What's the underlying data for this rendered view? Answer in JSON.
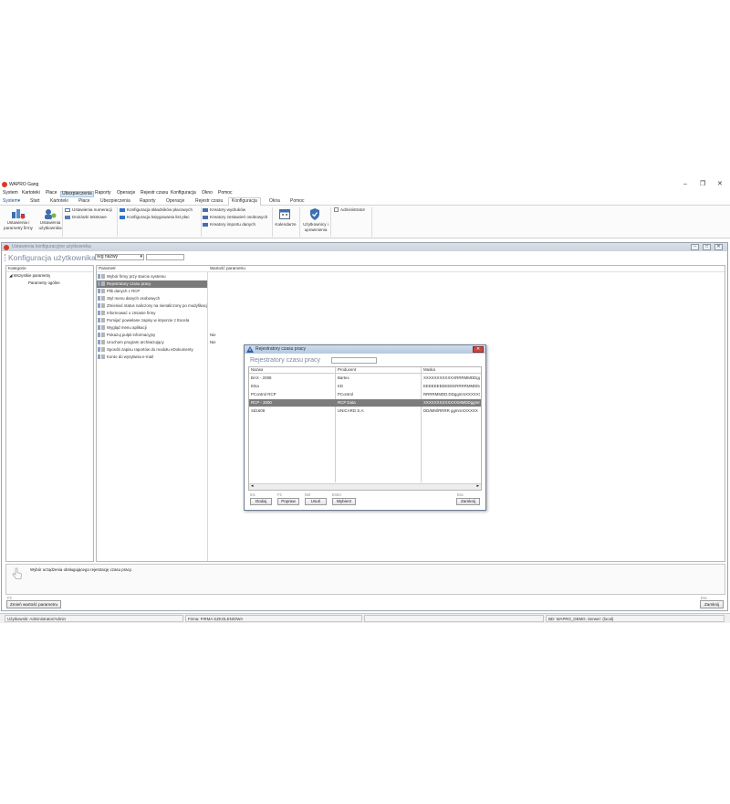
{
  "app": {
    "title": "WAPRO Gang",
    "window_controls": {
      "minimize": "–",
      "maximize": "❐",
      "close": "✕"
    }
  },
  "menu": [
    "System",
    "Kartoteki",
    "Płace",
    "Ubezpieczenia",
    "Raporty",
    "Operacje",
    "Rejestr czasu",
    "Konfiguracja",
    "Okno",
    "Pomoc"
  ],
  "menu_active": "Ubezpieczenia",
  "tabs": [
    "System",
    "Start",
    "Kartoteki",
    "Płace",
    "Ubezpieczenia",
    "Raporty",
    "Operacje",
    "Rejestr czasu",
    "Konfiguracja",
    "Okna",
    "Pomoc"
  ],
  "tab_active": "Konfiguracja",
  "ribbon": {
    "company_settings": "Ustawienia i parametry firmy",
    "user_settings": "Ustawienia użytkownika",
    "numbering": "Ustawienia numeracji",
    "text_printouts": "Druk/arki tekstowe",
    "payroll_config": "Konfiguracja składników płacowych",
    "ledger_config": "Konfiguracja księgowania list płac",
    "printout_wizards": "Kreatory wydruków",
    "staffing_wizards": "Kreatory zestawień osobowych",
    "import_wizards": "Kreatory importu danych",
    "calendars": "Kalendarze",
    "users_permissions": "Użytkownicy i uprawnienia",
    "administrator": "Administrator"
  },
  "child": {
    "window_title": "Ustawienia konfiguracyjne użytkownika",
    "page_title": "Konfiguracja użytkownika",
    "filter_value": "Wg nazwy",
    "categories_header": "Kategorie",
    "categories": [
      "Wszystkie parametry",
      "Parametry ogólne"
    ],
    "param_header": "Parametr",
    "value_header": "Wartość parametru",
    "params": [
      {
        "name": "Wybór firmy przy starcie systemu",
        "value": ""
      },
      {
        "name": "Rejestratory czasu pracy",
        "value": ""
      },
      {
        "name": "Plik danych z RCP",
        "value": ""
      },
      {
        "name": "Styl menu danych osobowych",
        "value": ""
      },
      {
        "name": "Zmieniać status naliczony na nienaliczony po modyfikacji",
        "value": ""
      },
      {
        "name": "Informować o zmianie firmy",
        "value": ""
      },
      {
        "name": "Pomijać powielane zapisy w imporcie z Excela",
        "value": ""
      },
      {
        "name": "Wygląd menu aplikacji",
        "value": ""
      },
      {
        "name": "Pokazuj pulpit informacyjny",
        "value": "Nie"
      },
      {
        "name": "Uruchom program archiwizujący",
        "value": "Nie"
      },
      {
        "name": "Sposób zapisu raportów do modułu eDokumenty",
        "value": ""
      },
      {
        "name": "Konto do wysyłania e-mail",
        "value": ""
      }
    ],
    "description": "Wybór urządzenia obsługującego rejestrację czasu pracy.",
    "change_key": "F2",
    "change_button": "Zmień wartość parametru",
    "close_key": "Esc",
    "close_button": "Zamknij"
  },
  "dialog": {
    "title": "Rejestratory czasu pracy",
    "heading": "Rejestratory czasu pracy",
    "columns": [
      "Nazwa",
      "Producent",
      "Maska"
    ],
    "rows": [
      {
        "name": "BAX - 2008",
        "producer": "Bartex",
        "mask": "XXXXXXXXXXXXRRRMMDDggmm"
      },
      {
        "name": "Elna",
        "producer": "KD",
        "mask": "EEEEEEEEEEEERRRRMMDDggmm"
      },
      {
        "name": "PControl RCP",
        "producer": "PControl",
        "mask": "RRRRMMDD:DDggmmXXXXXX"
      },
      {
        "name": "RCP - 2000",
        "producer": "RCP Data",
        "mask": "XXXXXXXXXXXXXMMDDggmmTK"
      },
      {
        "name": "Sd1608",
        "producer": "UNICARD S.A.",
        "mask": "DD/MM/RRRR ggmmXXXXXX"
      }
    ],
    "selected_row": 3,
    "buttons": [
      {
        "key": "Ins",
        "label": "Dodaj"
      },
      {
        "key": "F2",
        "label": "Popraw"
      },
      {
        "key": "Del",
        "label": "Usuń"
      },
      {
        "key": "Enter",
        "label": "Wybierz"
      }
    ],
    "close": {
      "key": "Esc",
      "label": "Zamknij"
    }
  },
  "status": {
    "user": "Użytkownik: Administrator/Admin",
    "company": "Firma: FIRMA SZKOLENIOWA",
    "db": "BD: WAPRO_DEMO, Serwer: (local)"
  },
  "colors": {
    "accent": "#d83a2a",
    "selection": "#7a7a7a",
    "child_title": "#7a8a9c"
  }
}
